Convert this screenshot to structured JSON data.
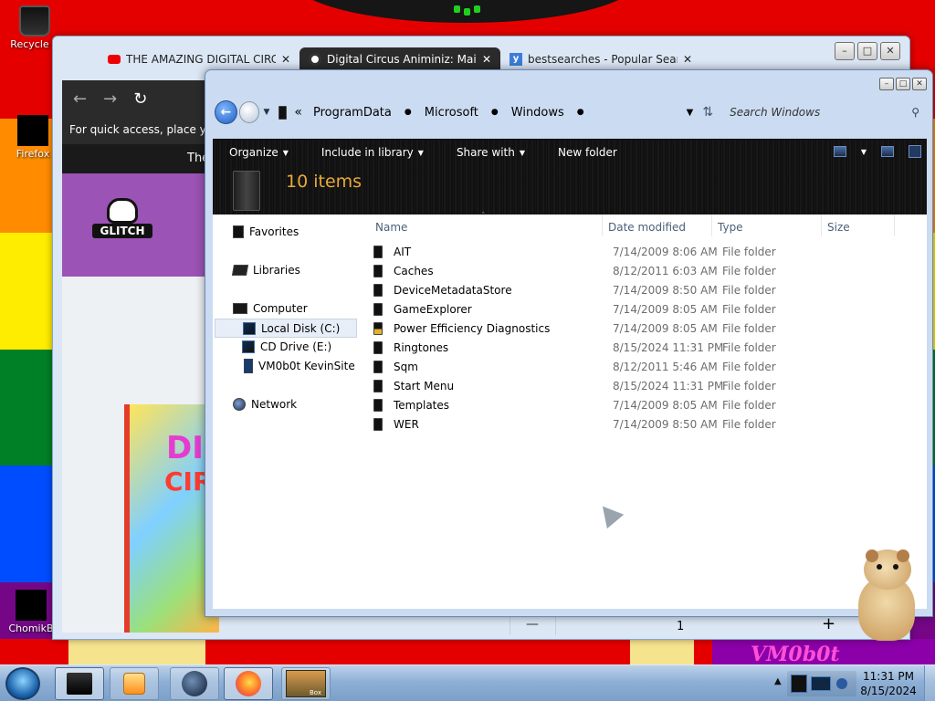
{
  "desktop": {
    "icons": [
      {
        "label": "Recycle B"
      },
      {
        "label": "Firefox"
      },
      {
        "label": "ChomikB"
      }
    ],
    "wallpaper_text": "VM0b0t"
  },
  "browser": {
    "tabs": [
      {
        "title": "THE AMAZING DIGITAL CIRCUS",
        "close": "✕"
      },
      {
        "title": "Digital Circus Animiniz: Main C",
        "close": "✕"
      },
      {
        "title": "bestsearches - Popular Search T",
        "close": "✕"
      }
    ],
    "new_tab": "+",
    "tab_list": "⌄",
    "quick_access": "For quick access, place your",
    "page_bar_text": "The",
    "logo_text": "GLITCH",
    "box_art": {
      "line1": "DIG",
      "line2": "CIR"
    },
    "status": {
      "zoom_minus": "—",
      "page": "1",
      "zoom_plus": "+"
    }
  },
  "explorer": {
    "breadcrumbs": [
      "ProgramData",
      "Microsoft",
      "Windows"
    ],
    "search_placeholder": "Search Windows",
    "toolbar": {
      "organize": "Organize",
      "include_in_library": "Include in library",
      "share_with": "Share with",
      "new_folder": "New folder"
    },
    "item_count": "10 items",
    "nav": {
      "favorites": "Favorites",
      "libraries": "Libraries",
      "computer": "Computer",
      "local_disk": "Local Disk (C:)",
      "cd_drive": "CD Drive (E:)",
      "site": "VM0b0t KevinSite",
      "network": "Network"
    },
    "columns": {
      "name": "Name",
      "date": "Date modified",
      "type": "Type",
      "size": "Size"
    },
    "files": [
      {
        "name": "AIT",
        "date": "7/14/2009 8:06 AM",
        "type": "File folder"
      },
      {
        "name": "Caches",
        "date": "8/12/2011 6:03 AM",
        "type": "File folder"
      },
      {
        "name": "DeviceMetadataStore",
        "date": "7/14/2009 8:50 AM",
        "type": "File folder"
      },
      {
        "name": "GameExplorer",
        "date": "7/14/2009 8:05 AM",
        "type": "File folder"
      },
      {
        "name": "Power Efficiency Diagnostics",
        "date": "7/14/2009 8:05 AM",
        "type": "File folder"
      },
      {
        "name": "Ringtones",
        "date": "8/15/2024 11:31 PM",
        "type": "File folder"
      },
      {
        "name": "Sqm",
        "date": "8/12/2011 5:46 AM",
        "type": "File folder"
      },
      {
        "name": "Start Menu",
        "date": "8/15/2024 11:31 PM",
        "type": "File folder"
      },
      {
        "name": "Templates",
        "date": "7/14/2009 8:05 AM",
        "type": "File folder"
      },
      {
        "name": "WER",
        "date": "7/14/2009 8:50 AM",
        "type": "File folder"
      }
    ]
  },
  "taskbar": {
    "box_label": "Box",
    "clock_time": "11:31 PM",
    "clock_date": "8/15/2024"
  },
  "colors": {
    "accent_count": "#e9a93a",
    "selection": "#e8eef7"
  }
}
